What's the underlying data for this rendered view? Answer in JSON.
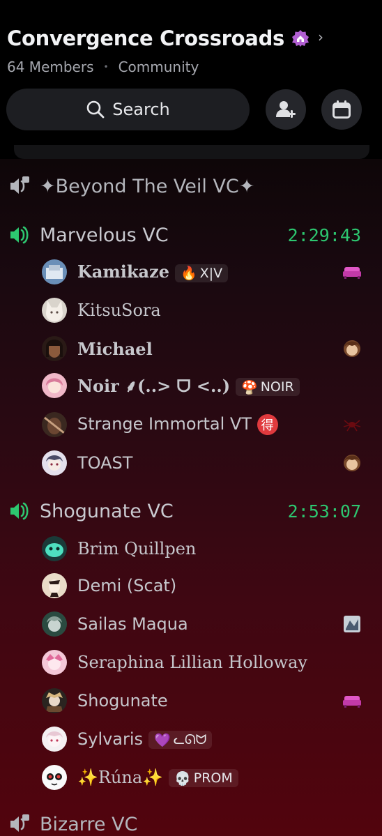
{
  "header": {
    "server_name": "Convergence Crossroads",
    "members": "64 Members",
    "separator": "•",
    "community": "Community",
    "search_label": "Search"
  },
  "channels": [
    {
      "name": "✦Beyond The Veil VC✦",
      "timer": ""
    },
    {
      "name": "Marvelous VC",
      "timer": "2:29:43"
    },
    {
      "name": "Shogunate VC",
      "timer": "2:53:07"
    },
    {
      "name": "Bizarre VC",
      "timer": ""
    }
  ],
  "marvelous_members": [
    {
      "name": "Kamikaze",
      "tag_icon": "🔥",
      "tag": "X|V",
      "right_icon": "sofa-icon"
    },
    {
      "name": "KitsuSora"
    },
    {
      "name": "Michael",
      "right_icon": "avatar-sticker-icon"
    },
    {
      "name": "Noir ⸙(..> ᗜ <..)",
      "tag_icon": "🍄",
      "tag": "NOIR"
    },
    {
      "name": "Strange Immortal VT",
      "badge": "得",
      "right_icon": "spider-icon"
    },
    {
      "name": "TOAST",
      "right_icon": "avatar-sticker-icon"
    }
  ],
  "shogunate_members": [
    {
      "name": "Brim Quillpen"
    },
    {
      "name": "Demi (Scat)"
    },
    {
      "name": "Sailas Maqua",
      "right_icon": "sticker-icon"
    },
    {
      "name": "Seraphina Lillian Holloway"
    },
    {
      "name": "Shogunate",
      "right_icon": "sofa-icon"
    },
    {
      "name": "Sylvaris",
      "tag_icon": "💜",
      "tag": "ᓚᘏᗢ"
    },
    {
      "name": "✨Rúna✨",
      "tag_icon": "💀",
      "tag": "PROM"
    }
  ],
  "colors": {
    "timer": "#2dc770",
    "speaker_active": "#2dc770",
    "speaker_inactive": "#b4b6bc",
    "background_bottom": "#52040d"
  }
}
